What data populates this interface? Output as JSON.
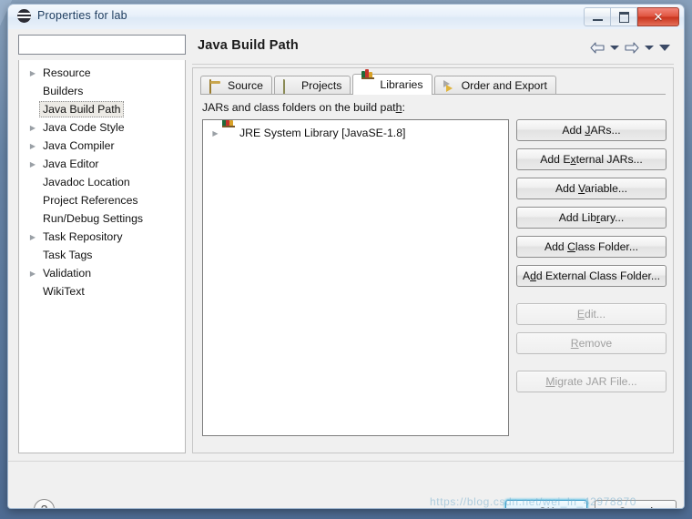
{
  "window": {
    "title": "Properties for lab",
    "icon": "eclipse-icon",
    "controls": {
      "minimize": "–",
      "maximize": "□",
      "close": "✕"
    }
  },
  "sidebar": {
    "filter": {
      "value": "",
      "placeholder": ""
    },
    "items": [
      {
        "label": "Resource",
        "expandable": true,
        "selected": false
      },
      {
        "label": "Builders",
        "expandable": false,
        "selected": false
      },
      {
        "label": "Java Build Path",
        "expandable": false,
        "selected": true
      },
      {
        "label": "Java Code Style",
        "expandable": true,
        "selected": false
      },
      {
        "label": "Java Compiler",
        "expandable": true,
        "selected": false
      },
      {
        "label": "Java Editor",
        "expandable": true,
        "selected": false
      },
      {
        "label": "Javadoc Location",
        "expandable": false,
        "selected": false
      },
      {
        "label": "Project References",
        "expandable": false,
        "selected": false
      },
      {
        "label": "Run/Debug Settings",
        "expandable": false,
        "selected": false
      },
      {
        "label": "Task Repository",
        "expandable": true,
        "selected": false
      },
      {
        "label": "Task Tags",
        "expandable": false,
        "selected": false
      },
      {
        "label": "Validation",
        "expandable": true,
        "selected": false
      },
      {
        "label": "WikiText",
        "expandable": false,
        "selected": false
      }
    ]
  },
  "page": {
    "title": "Java Build Path",
    "nav": {
      "back": "back-arrow",
      "back_menu": "chevron-down",
      "forward": "forward-arrow",
      "forward_menu": "chevron-down",
      "view_menu": "chevron-down"
    },
    "tabs": [
      {
        "label": "Source",
        "icon": "package-icon",
        "active": false
      },
      {
        "label": "Projects",
        "icon": "folder-icon",
        "active": false
      },
      {
        "label": "Libraries",
        "icon": "books-icon",
        "active": true
      },
      {
        "label": "Order and Export",
        "icon": "order-icon",
        "active": false
      }
    ],
    "list_label": "JARs and class folders on the build path:",
    "list_label_mnemonic": "h",
    "entries": [
      {
        "label": "JRE System Library [JavaSE-1.8]",
        "icon": "books-icon",
        "expandable": true
      }
    ],
    "buttons": [
      {
        "label": "Add JARs...",
        "mnemonic": "J",
        "enabled": true
      },
      {
        "label": "Add External JARs...",
        "mnemonic": "x",
        "enabled": true
      },
      {
        "label": "Add Variable...",
        "mnemonic": "V",
        "enabled": true
      },
      {
        "label": "Add Library...",
        "mnemonic": "r",
        "enabled": true
      },
      {
        "label": "Add Class Folder...",
        "mnemonic": "C",
        "enabled": true
      },
      {
        "label": "Add External Class Folder...",
        "mnemonic": "d",
        "enabled": true
      },
      {
        "label": "Edit...",
        "mnemonic": "E",
        "enabled": false
      },
      {
        "label": "Remove",
        "mnemonic": "R",
        "enabled": false
      },
      {
        "label": "Migrate JAR File...",
        "mnemonic": "M",
        "enabled": false
      }
    ]
  },
  "footer": {
    "help": "?",
    "ok": "OK",
    "cancel": "Cancel"
  },
  "watermark": "https://blog.csdn.net/wei_ln_42978870",
  "colors": {
    "desktop": "#5b7ca8",
    "dialog_bg": "#f0f0f0",
    "titlebar": "#e7f0fa",
    "close_button": "#c8321c",
    "default_button_glow": "#4ebee6",
    "selection": "#eceae5"
  }
}
